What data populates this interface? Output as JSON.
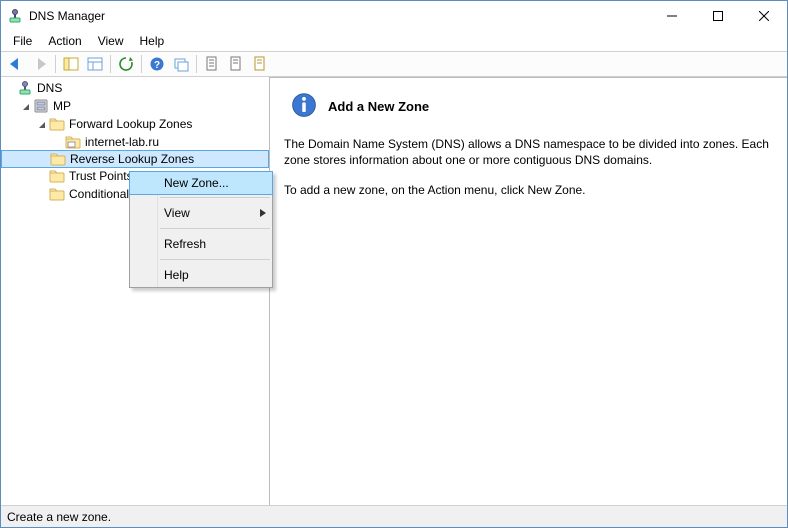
{
  "window": {
    "title": "DNS Manager"
  },
  "menu": {
    "file": "File",
    "action": "Action",
    "view": "View",
    "help": "Help"
  },
  "tree": {
    "root": "DNS",
    "server": "MP",
    "fwd": "Forward Lookup Zones",
    "fwd_child": "internet-lab.ru",
    "rev": "Reverse Lookup Zones",
    "trust": "Trust Points",
    "cond": "Conditional Forwarders"
  },
  "context": {
    "new_zone": "New Zone...",
    "view": "View",
    "refresh": "Refresh",
    "help": "Help"
  },
  "right": {
    "title": "Add a New Zone",
    "para1": "The Domain Name System (DNS) allows a DNS namespace to be divided into zones. Each zone stores information about one or more contiguous DNS domains.",
    "para2": "To add a new zone, on the Action menu, click New Zone."
  },
  "status": {
    "text": "Create a new zone."
  }
}
